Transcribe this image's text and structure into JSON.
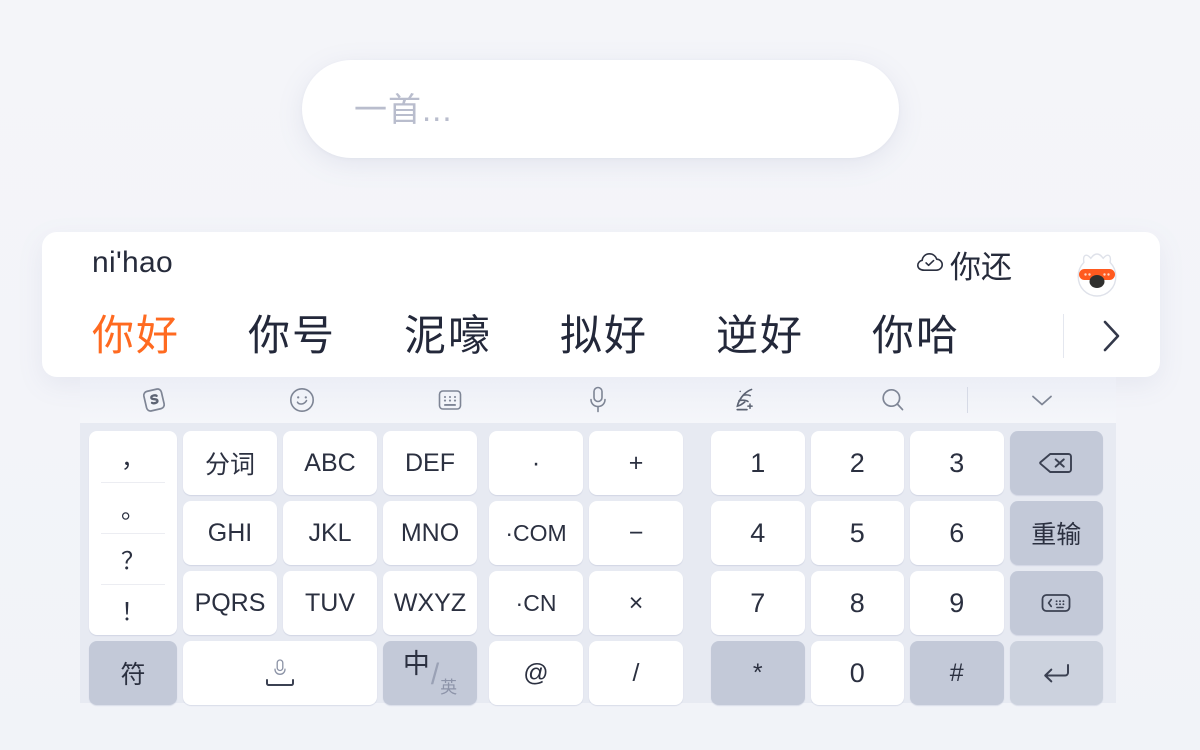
{
  "text_input": {
    "placeholder": "一首...",
    "value": ""
  },
  "candidate_bar": {
    "pinyin": "ni'hao",
    "cloud_icon": "cloud-check-icon",
    "cloud_candidate": "你还",
    "mascot": "sogou-fox-mascot",
    "expand_icon": "chevron-right-icon",
    "active_color": "#ff6a20",
    "candidates": [
      {
        "text": "你好",
        "active": true
      },
      {
        "text": "你号",
        "active": false
      },
      {
        "text": "泥嚎",
        "active": false
      },
      {
        "text": "拟好",
        "active": false
      },
      {
        "text": "逆好",
        "active": false
      },
      {
        "text": "你哈",
        "active": false
      }
    ]
  },
  "toolbar": {
    "items": [
      {
        "icon": "sogou-logo-icon",
        "label": "Sogou"
      },
      {
        "icon": "emoji-smiley-icon",
        "label": "表情"
      },
      {
        "icon": "keyboard-layout-icon",
        "label": "键盘"
      },
      {
        "icon": "microphone-icon",
        "label": "语音"
      },
      {
        "icon": "handwriting-pen-icon",
        "label": "手写"
      },
      {
        "icon": "search-icon",
        "label": "搜索"
      }
    ],
    "collapse_icon": "chevron-down-icon"
  },
  "keyboard": {
    "punctuation_key": {
      "name": "punctuation-column-key",
      "rows": [
        "，",
        "。",
        "？",
        "！"
      ]
    },
    "left_keys": [
      {
        "label": "分词",
        "name": "key-fenci",
        "style": "white"
      },
      {
        "label": "ABC",
        "name": "key-abc",
        "style": "white"
      },
      {
        "label": "DEF",
        "name": "key-def",
        "style": "white"
      },
      {
        "label": "GHI",
        "name": "key-ghi",
        "style": "white"
      },
      {
        "label": "JKL",
        "name": "key-jkl",
        "style": "white"
      },
      {
        "label": "MNO",
        "name": "key-mno",
        "style": "white"
      },
      {
        "label": "PQRS",
        "name": "key-pqrs",
        "style": "white"
      },
      {
        "label": "TUV",
        "name": "key-tuv",
        "style": "white"
      },
      {
        "label": "WXYZ",
        "name": "key-wxyz",
        "style": "white"
      }
    ],
    "bottom_left": {
      "symbol_key": {
        "label": "符",
        "name": "key-symbols",
        "style": "gray"
      },
      "space_key": {
        "label": "",
        "name": "key-space",
        "icon": "microphone-space-icon",
        "style": "white"
      },
      "lang_key": {
        "zh": "中",
        "slash": "/",
        "en": "英",
        "name": "key-language-toggle",
        "style": "gray"
      }
    },
    "mid_keys": [
      {
        "label": "·",
        "name": "key-dot",
        "style": "white"
      },
      {
        "label": "+",
        "name": "key-plus",
        "style": "white"
      },
      {
        "label": "·COM",
        "name": "key-dotcom",
        "style": "white"
      },
      {
        "label": "−",
        "name": "key-minus",
        "style": "white"
      },
      {
        "label": "·CN",
        "name": "key-dotcn",
        "style": "white"
      },
      {
        "label": "×",
        "name": "key-multiply",
        "style": "white"
      },
      {
        "label": "@",
        "name": "key-at",
        "style": "white"
      },
      {
        "label": "/",
        "name": "key-slash",
        "style": "white"
      }
    ],
    "numpad": [
      {
        "label": "1",
        "name": "key-1",
        "style": "white"
      },
      {
        "label": "2",
        "name": "key-2",
        "style": "white"
      },
      {
        "label": "3",
        "name": "key-3",
        "style": "white"
      },
      {
        "label": "",
        "name": "key-backspace",
        "style": "gray",
        "icon": "backspace-icon"
      },
      {
        "label": "4",
        "name": "key-4",
        "style": "white"
      },
      {
        "label": "5",
        "name": "key-5",
        "style": "white"
      },
      {
        "label": "6",
        "name": "key-6",
        "style": "white"
      },
      {
        "label": "重输",
        "name": "key-redo-input",
        "style": "gray"
      },
      {
        "label": "7",
        "name": "key-7",
        "style": "white"
      },
      {
        "label": "8",
        "name": "key-8",
        "style": "white"
      },
      {
        "label": "9",
        "name": "key-9",
        "style": "white"
      },
      {
        "label": "",
        "name": "key-hide-keyboard",
        "style": "gray",
        "icon": "keyboard-collapse-icon"
      },
      {
        "label": "*",
        "name": "key-asterisk",
        "style": "gray"
      },
      {
        "label": "0",
        "name": "key-0",
        "style": "white"
      },
      {
        "label": "#",
        "name": "key-hash",
        "style": "gray"
      },
      {
        "label": "",
        "name": "key-enter",
        "style": "gray",
        "icon": "enter-return-icon"
      }
    ]
  },
  "colors": {
    "page_bg": "#f4f5f9",
    "keyboard_bg": "#e7eaf2",
    "key_white": "#ffffff",
    "key_gray": "#c3c9d8",
    "accent_orange": "#ff6a20",
    "text_dark": "#262b3b",
    "placeholder_gray": "#b9bdcd"
  }
}
